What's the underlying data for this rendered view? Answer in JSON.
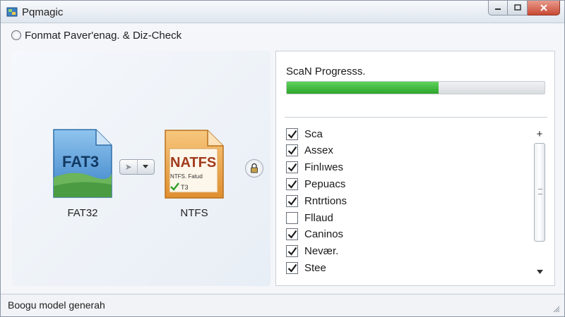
{
  "window": {
    "title": "Pqmagic"
  },
  "toolbar": {
    "operation_label": "Fonmat Paver'enag. & Diz-Check"
  },
  "left_panel": {
    "source": {
      "icon_text": "FAT3",
      "caption": "FAT32",
      "color": "#4a8fd0"
    },
    "target": {
      "icon_text": "NATFS",
      "icon_line1": "NTFS. Fatud",
      "icon_line2": "T3",
      "caption": "NTFS",
      "color": "#e8a24a"
    },
    "convert_icon": "arrow-right-icon",
    "lock_icon": "lock-icon"
  },
  "right_panel": {
    "scan_title": "ScaN Progresss.",
    "progress_percent": 59,
    "progress_color": "#3fb83c",
    "items": [
      {
        "label": "Sca",
        "checked": true
      },
      {
        "label": "Assex",
        "checked": true
      },
      {
        "label": "Finlıwes",
        "checked": true
      },
      {
        "label": "Pepuacs",
        "checked": true
      },
      {
        "label": "Rntrtions",
        "checked": true
      },
      {
        "label": "Fllaud",
        "checked": false
      },
      {
        "label": "Caninos",
        "checked": true
      },
      {
        "label": "Nevær.",
        "checked": true
      },
      {
        "label": "Stee",
        "checked": true
      }
    ],
    "scroll_up_label": "+"
  },
  "status": {
    "text": "Boogu model generah"
  }
}
